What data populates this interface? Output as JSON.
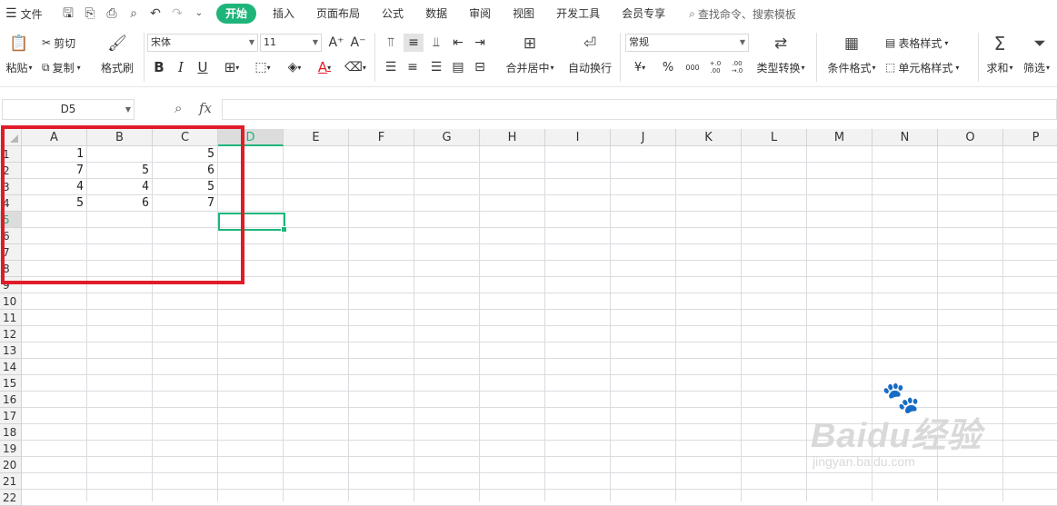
{
  "menubar": {
    "file_label": "文件",
    "tabs": [
      "开始",
      "插入",
      "页面布局",
      "公式",
      "数据",
      "审阅",
      "视图",
      "开发工具",
      "会员专享"
    ],
    "search_placeholder": "查找命令、搜索模板"
  },
  "ribbon": {
    "paste": "粘贴",
    "cut": "剪切",
    "copy": "复制",
    "format_painter": "格式刷",
    "font_name": "宋体",
    "font_size": "11",
    "merge_center": "合并居中",
    "wrap_text": "自动换行",
    "number_format": "常规",
    "type_convert": "类型转换",
    "conditional_format": "条件格式",
    "table_style": "表格样式",
    "cell_style": "单元格样式",
    "sum": "求和",
    "filter": "筛选",
    "currency_symbol": "¥",
    "percent_symbol": "%",
    "thousands_symbol": "000",
    "inc_decimal": "+.0 .00",
    "dec_decimal": ".00 →.0"
  },
  "formula_bar": {
    "name_box": "D5",
    "fx_label": "fx",
    "formula": ""
  },
  "sheet": {
    "columns": [
      "A",
      "B",
      "C",
      "D",
      "E",
      "F",
      "G",
      "H",
      "I",
      "J",
      "K",
      "L",
      "M",
      "N",
      "O",
      "P"
    ],
    "rows": [
      "1",
      "2",
      "3",
      "4",
      "5",
      "6",
      "7",
      "8",
      "9",
      "10",
      "11",
      "12",
      "13",
      "14",
      "15",
      "16",
      "17",
      "18",
      "19",
      "20",
      "21",
      "22"
    ],
    "selected_column": "D",
    "selected_row": "5",
    "cells": [
      [
        "1",
        "",
        "5"
      ],
      [
        "7",
        "5",
        "6"
      ],
      [
        "4",
        "4",
        "5"
      ],
      [
        "5",
        "6",
        "7"
      ]
    ]
  },
  "watermark": {
    "brand": "Baidu经验",
    "url": "jingyan.baidu.com"
  },
  "colors": {
    "accent": "#1fb57a",
    "highlight_box": "#e01c28"
  }
}
